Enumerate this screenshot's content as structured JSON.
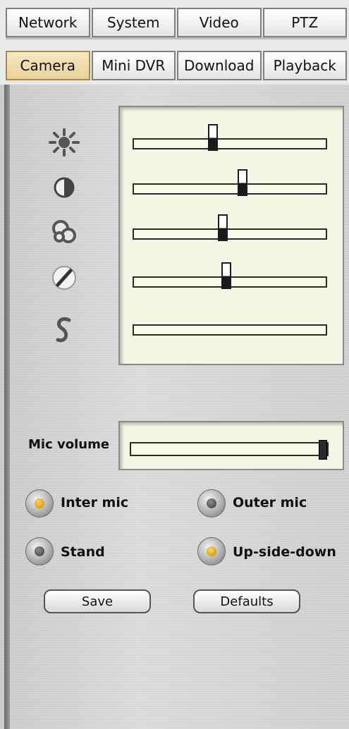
{
  "tabs_row1": [
    "Network",
    "System",
    "Video",
    "PTZ"
  ],
  "tabs_row2": [
    "Camera",
    "Mini DVR",
    "Download",
    "Playback"
  ],
  "active_tab": "Camera",
  "image_sliders": [
    {
      "icon": "brightness-icon",
      "value": 0.41
    },
    {
      "icon": "contrast-icon",
      "value": 0.57
    },
    {
      "icon": "saturation-icon",
      "value": 0.46
    },
    {
      "icon": "sharpness-icon",
      "value": 0.48
    },
    {
      "icon": "hue-icon",
      "value": null
    }
  ],
  "mic": {
    "label": "Mic volume",
    "value": 1.0
  },
  "radios": [
    {
      "label": "Inter mic",
      "checked": true
    },
    {
      "label": "Outer mic",
      "checked": false
    },
    {
      "label": "Stand",
      "checked": false
    },
    {
      "label": "Up-side-down",
      "checked": true
    }
  ],
  "buttons": {
    "save": "Save",
    "defaults": "Defaults"
  },
  "colors": {
    "active_tab": "#e9d19c",
    "slider_panel": "#f6f6e4",
    "radio_on": "#e0a800"
  }
}
